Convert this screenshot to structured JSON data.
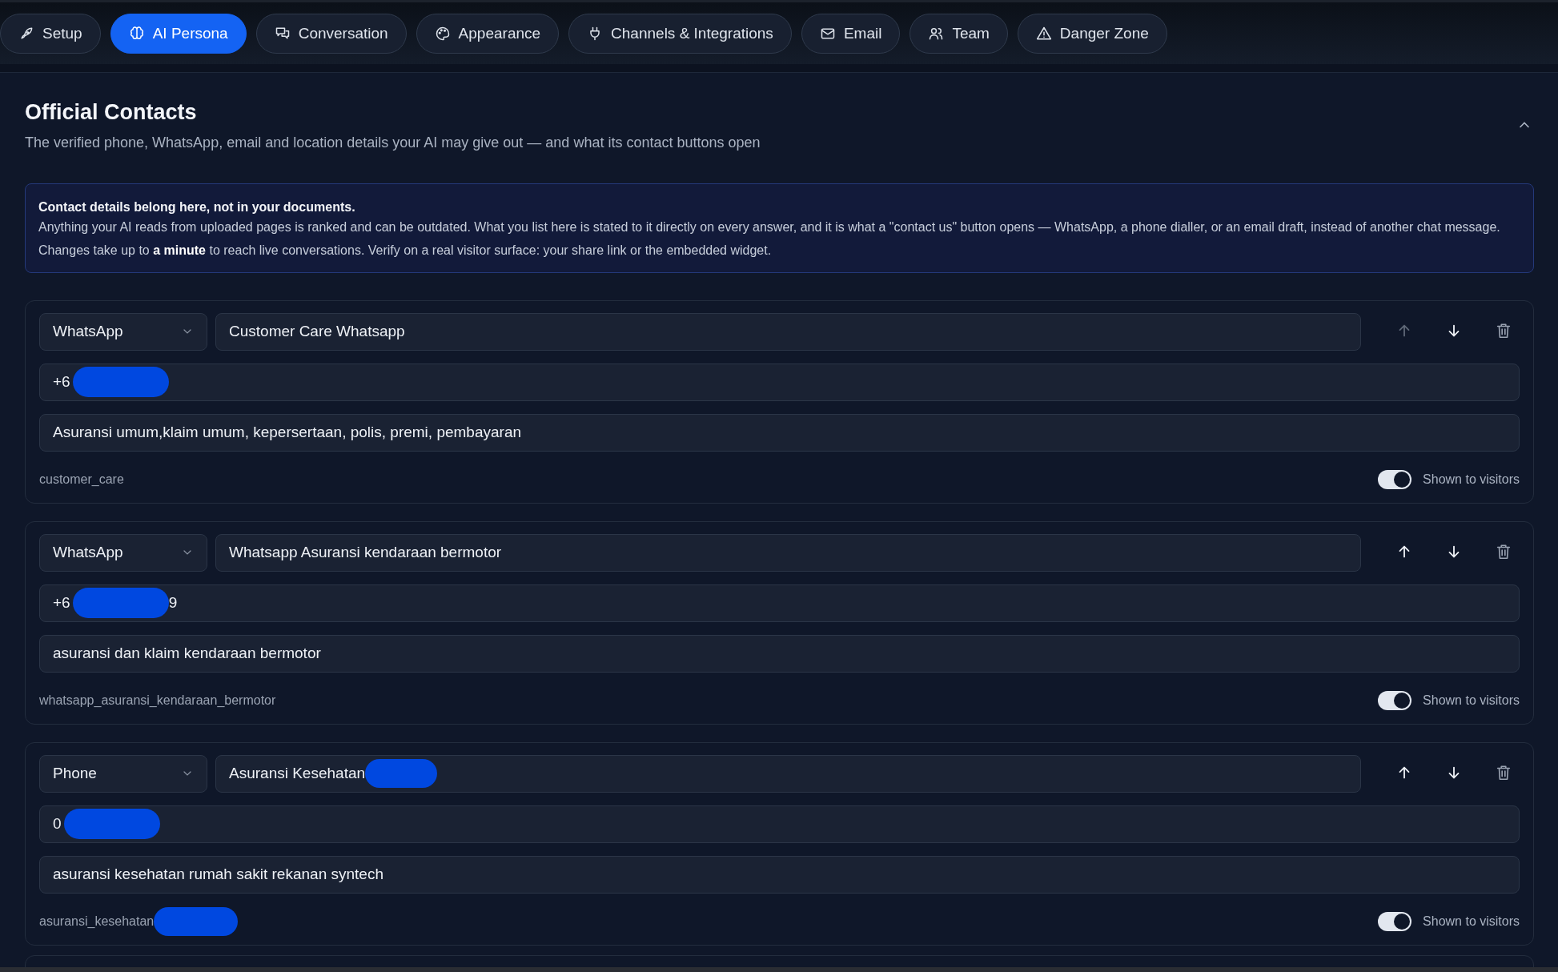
{
  "tabs": [
    {
      "label": "Setup",
      "selected": false
    },
    {
      "label": "AI Persona",
      "selected": true
    },
    {
      "label": "Conversation",
      "selected": false
    },
    {
      "label": "Appearance",
      "selected": false
    },
    {
      "label": "Channels & Integrations",
      "selected": false
    },
    {
      "label": "Email",
      "selected": false
    },
    {
      "label": "Team",
      "selected": false
    },
    {
      "label": "Danger Zone",
      "selected": false
    }
  ],
  "section": {
    "title": "Official Contacts",
    "subtitle": "The verified phone, WhatsApp, email and location details your AI may give out — and what its contact buttons open",
    "expanded": true
  },
  "notice": {
    "heading": "Contact details belong here, not in your documents.",
    "body": "Anything your AI reads from uploaded pages is ranked and can be outdated. What you list here is stated to it directly on every answer, and it is what a \"contact us\" button opens — WhatsApp, a phone dialler, or an email draft, instead of another chat message.",
    "note": "Changes take up to **a minute** to reach live conversations. Verify on a real visitor surface: your share link or the embedded widget."
  },
  "contacts": [
    {
      "type": "WhatsApp",
      "label": {
        "text": "Customer Care Whatsapp",
        "redacted": false
      },
      "number": {
        "before": "+6",
        "redacted": true
      },
      "topics": "Asuransi umum,klaim umum, kepersertaan, polis, premi, pembayaran",
      "key": {
        "text": "customer_care",
        "redacted": false
      },
      "can_move_up": false,
      "shown": true,
      "shown_label": "Shown to visitors"
    },
    {
      "type": "WhatsApp",
      "label": {
        "text": "Whatsapp Asuransi kendaraan bermotor",
        "redacted": false
      },
      "number": {
        "before": "+6",
        "after": "9",
        "redacted": true
      },
      "topics": "asuransi dan klaim kendaraan bermotor",
      "key": {
        "text": "whatsapp_asuransi_kendaraan_bermotor",
        "redacted": false
      },
      "can_move_up": true,
      "shown": true,
      "shown_label": "Shown to visitors"
    },
    {
      "type": "Phone",
      "label": {
        "text": "Asuransi Kesehatan",
        "redacted": true
      },
      "number": {
        "before": "0",
        "redacted": true
      },
      "topics": "asuransi kesehatan rumah sakit rekanan syntech",
      "key": {
        "text": "asuransi_kesehatan",
        "redacted": true
      },
      "can_move_up": true,
      "shown": true,
      "shown_label": "Shown to visitors"
    }
  ]
}
